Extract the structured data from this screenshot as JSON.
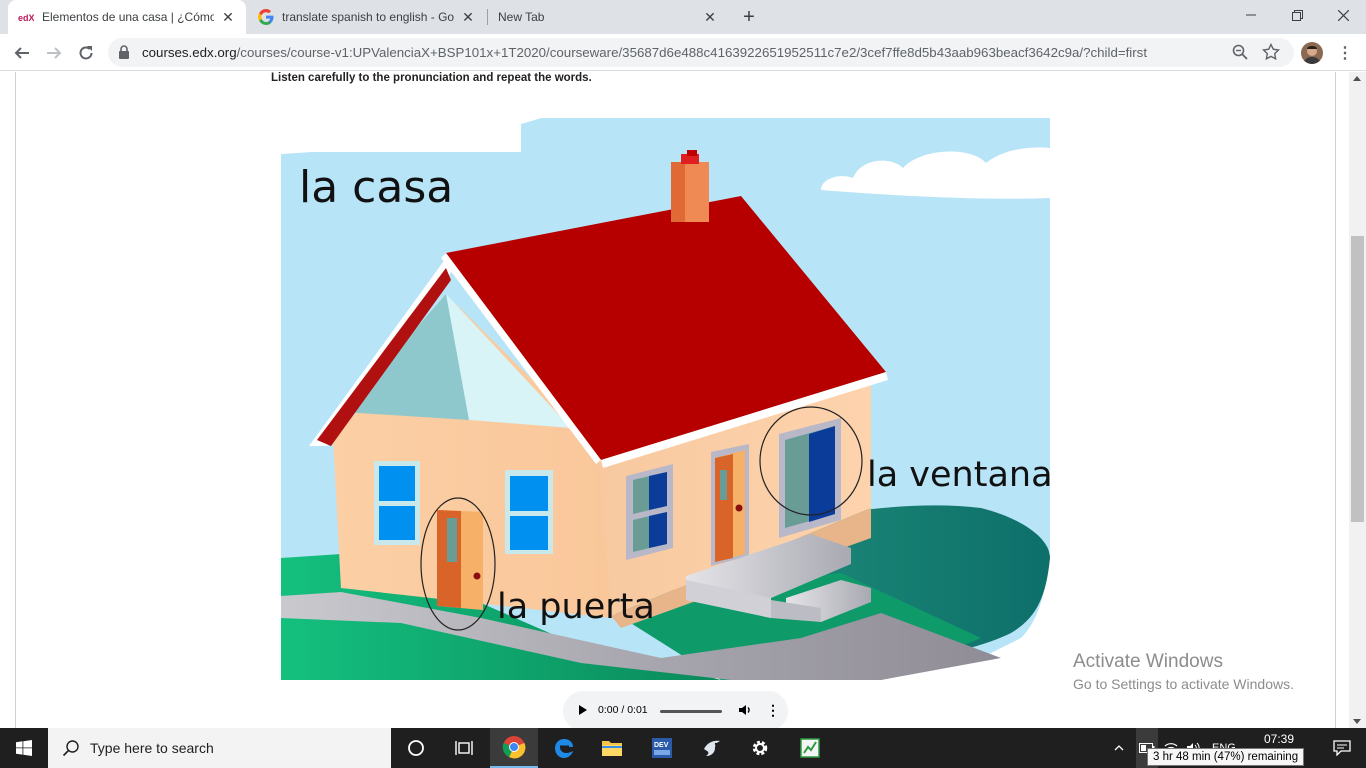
{
  "tabs": [
    {
      "title": "Elementos de una casa | ¿Cómo e",
      "favicon": "edx-logo",
      "active": true
    },
    {
      "title": "translate spanish to english - Goo",
      "favicon": "google-logo",
      "active": false
    },
    {
      "title": "New Tab",
      "favicon": "",
      "active": false
    }
  ],
  "edx_logo_text": "edX",
  "toolbar": {
    "url_domain": "courses.edx.org",
    "url_path": "/courses/course-v1:UPValenciaX+BSP101x+1T2020/courseware/35687d6e488c4163922651952511c7e2/3cef7ffe8d5b43aab963beacf3642c9a/?child=first"
  },
  "page": {
    "instruction": "Listen carefully to the pronunciation and repeat the words.",
    "labels": {
      "house": "la casa",
      "window": "la ventana",
      "door": "la puerta"
    },
    "audio": {
      "time": "0:00 / 0:01",
      "progress": 0
    }
  },
  "watermark": {
    "line1": "Activate Windows",
    "line2": "Go to Settings to activate Windows."
  },
  "taskbar": {
    "search_placeholder": "Type here to search",
    "tray_lang": "ENG",
    "time": "07:39",
    "battery_tooltip": "3 hr 48 min (47%) remaining"
  }
}
